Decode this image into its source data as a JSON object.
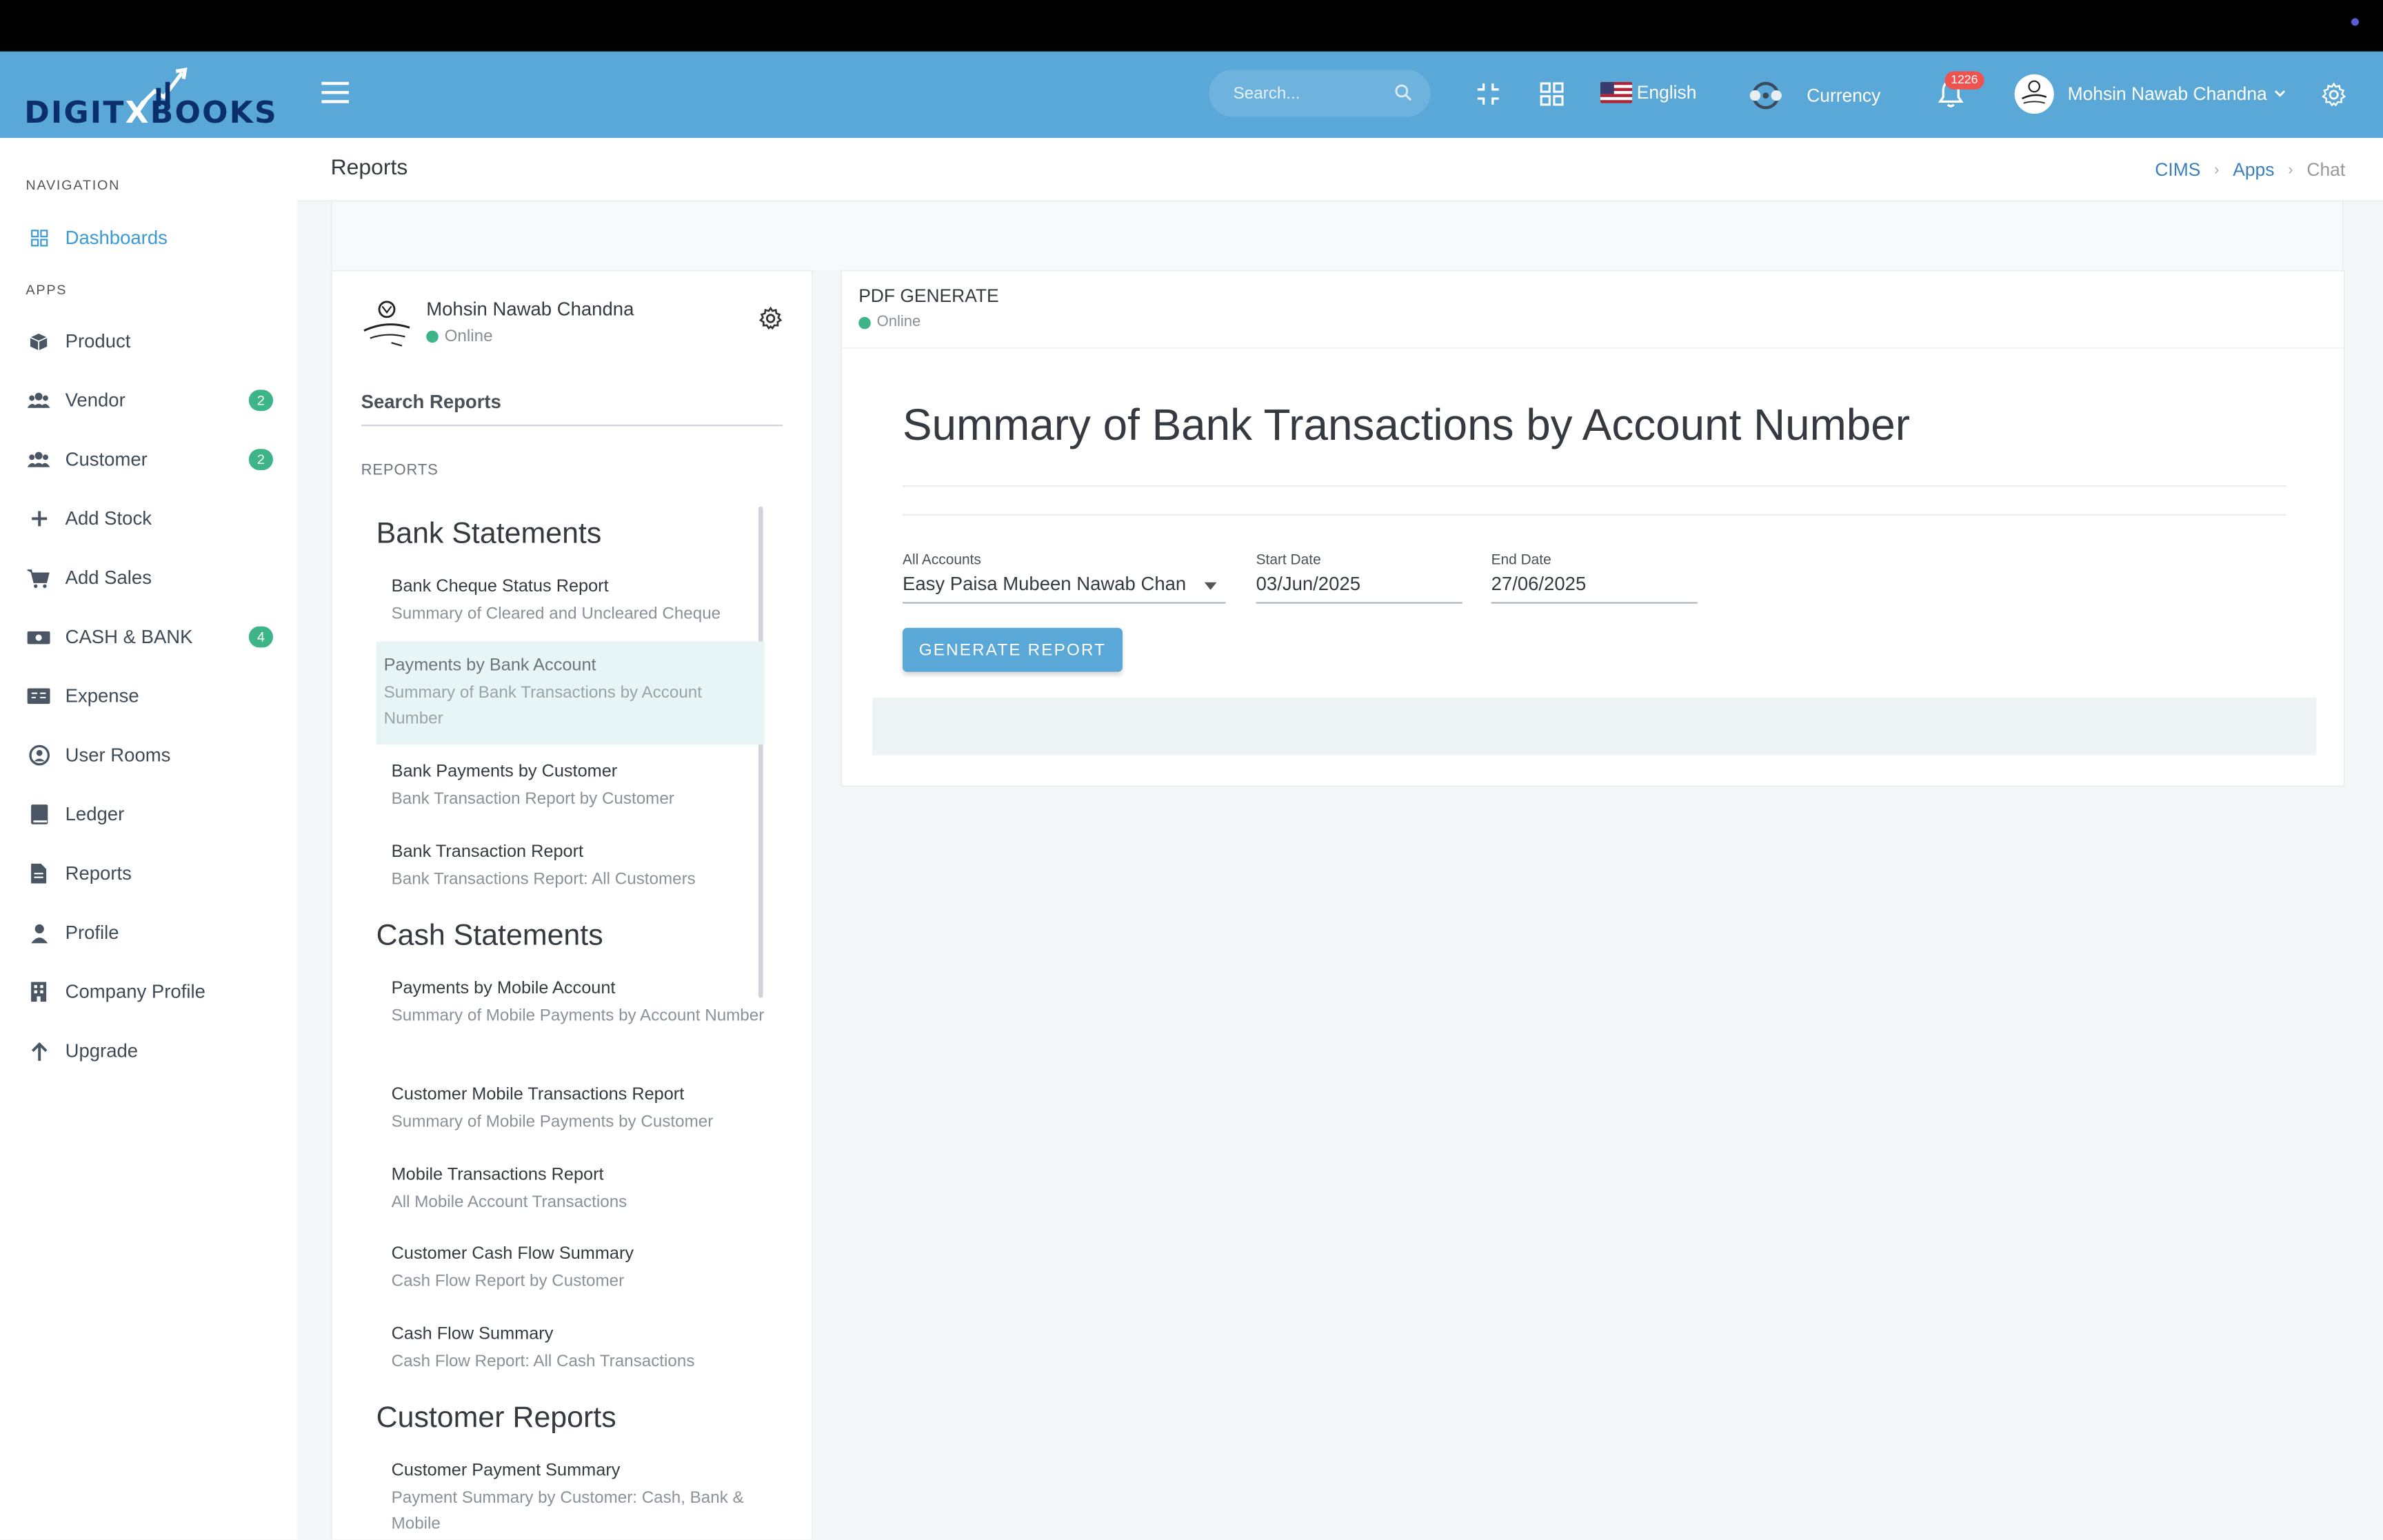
{
  "header": {
    "logo_text_a": "DIGIT",
    "logo_text_b": "X",
    "logo_text_c": "BOOKS",
    "search_placeholder": "Search...",
    "language": "English",
    "currency_label": "Currency",
    "notification_count": "1226",
    "user_name": "Mohsin Nawab Chandna"
  },
  "sidebar": {
    "nav_title": "NAVIGATION",
    "apps_title": "APPS",
    "dashboards": "Dashboards",
    "items": [
      {
        "label": "Product",
        "badge": ""
      },
      {
        "label": "Vendor",
        "badge": "2"
      },
      {
        "label": "Customer",
        "badge": "2"
      },
      {
        "label": "Add Stock",
        "badge": ""
      },
      {
        "label": "Add Sales",
        "badge": ""
      },
      {
        "label": "CASH & BANK",
        "badge": "4"
      },
      {
        "label": "Expense",
        "badge": ""
      },
      {
        "label": "User Rooms",
        "badge": ""
      },
      {
        "label": "Ledger",
        "badge": ""
      },
      {
        "label": "Reports",
        "badge": ""
      },
      {
        "label": "Profile",
        "badge": ""
      },
      {
        "label": "Company Profile",
        "badge": ""
      },
      {
        "label": "Upgrade",
        "badge": ""
      }
    ]
  },
  "page": {
    "title": "Reports",
    "breadcrumb": [
      "CIMS",
      "Apps",
      "Chat"
    ]
  },
  "left_panel": {
    "user_name": "Mohsin Nawab Chandna",
    "status": "Online",
    "search_placeholder": "Search Reports",
    "reports_label": "REPORTS",
    "sections": [
      {
        "heading": "Bank Statements",
        "items": [
          {
            "title": "Bank Cheque Status Report",
            "subtitle": "Summary of Cleared and Uncleared Cheque"
          },
          {
            "title": "Payments by Bank Account",
            "subtitle": "Summary of Bank Transactions by Account Number"
          },
          {
            "title": "Bank Payments by Customer",
            "subtitle": "Bank Transaction Report by Customer"
          },
          {
            "title": "Bank Transaction Report",
            "subtitle": "Bank Transactions Report: All Customers"
          }
        ]
      },
      {
        "heading": "Cash Statements",
        "items": [
          {
            "title": "Payments by Mobile Account",
            "subtitle": "Summary of Mobile Payments by Account Number"
          },
          {
            "title": "Customer Mobile Transactions Report",
            "subtitle": "Summary of Mobile Payments by Customer"
          },
          {
            "title": "Mobile Transactions Report",
            "subtitle": "All Mobile Account Transactions"
          },
          {
            "title": "Customer Cash Flow Summary",
            "subtitle": "Cash Flow Report by Customer"
          },
          {
            "title": "Cash Flow Summary",
            "subtitle": "Cash Flow Report: All Cash Transactions"
          }
        ]
      },
      {
        "heading": "Customer Reports",
        "items": [
          {
            "title": "Customer Payment Summary",
            "subtitle": "Payment Summary by Customer: Cash, Bank & Mobile"
          }
        ]
      }
    ]
  },
  "right_panel": {
    "title": "PDF GENERATE",
    "status": "Online",
    "report_heading": "Summary of Bank Transactions by Account Number",
    "accounts_label": "All Accounts",
    "accounts_value": "Easy Paisa Mubeen Nawab Chan",
    "start_label": "Start Date",
    "start_value": "03/Jun/2025",
    "end_label": "End Date",
    "end_value": "27/06/2025",
    "generate_label": "GENERATE REPORT"
  },
  "colors": {
    "header_bg": "#5aa8d8",
    "accent": "#3a9ad6",
    "badge_green": "#3eb489",
    "badge_red": "#ef5350",
    "selected_bg": "#e8f5f7"
  }
}
